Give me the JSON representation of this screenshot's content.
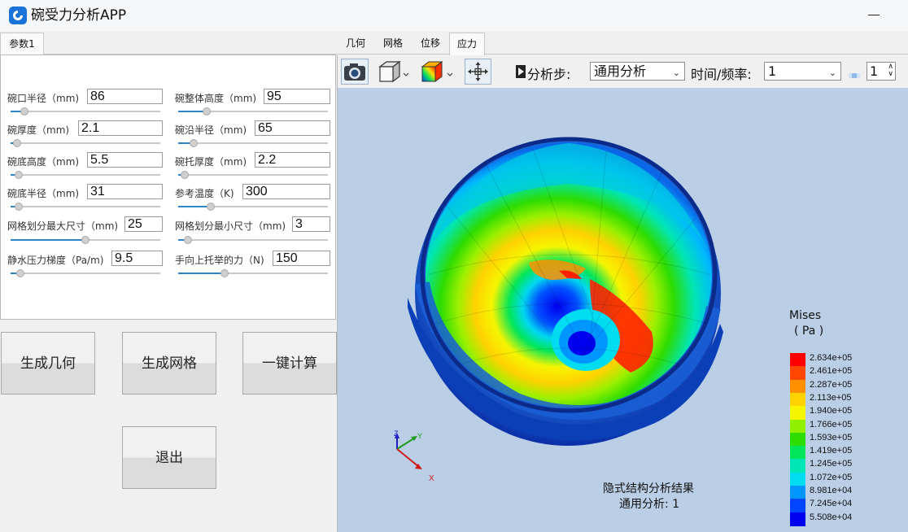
{
  "app": {
    "title": "碗受力分析APP",
    "colors": {
      "accent": "#2c86c9",
      "viewport_bg": "#bacfe6"
    }
  },
  "left_tabs": [
    {
      "label": "参数1",
      "active": true
    }
  ],
  "right_tabs": [
    {
      "label": "几何",
      "active": false
    },
    {
      "label": "网格",
      "active": false
    },
    {
      "label": "位移",
      "active": false
    },
    {
      "label": "应力",
      "active": true
    }
  ],
  "params": {
    "bowl_mouth_radius": {
      "label": "碗口半径（mm)",
      "value": "86",
      "slider": 0.07
    },
    "bowl_body_height": {
      "label": "碗整体高度（mm)",
      "value": "95",
      "slider": 0.17
    },
    "bowl_thickness": {
      "label": "碗厚度（mm)",
      "value": "2.1",
      "slider": 0.02
    },
    "rim_radius": {
      "label": "碗沿半径（mm)",
      "value": "65",
      "slider": 0.08
    },
    "bottom_height": {
      "label": "碗底高度（mm)",
      "value": "5.5",
      "slider": 0.03
    },
    "foot_thickness": {
      "label": "碗托厚度（mm)",
      "value": "2.2",
      "slider": 0.02
    },
    "bottom_radius": {
      "label": "碗底半径（mm)",
      "value": "31",
      "slider": 0.03
    },
    "ref_temperature": {
      "label": "参考温度（K)",
      "value": "300",
      "slider": 0.2
    },
    "mesh_max": {
      "label": "网格划分最大尺寸（mm)",
      "value": "25",
      "slider": 0.5
    },
    "mesh_min": {
      "label": "网格划分最小尺寸（mm)",
      "value": "3",
      "slider": 0.04
    },
    "hydro_gradient": {
      "label": "静水压力梯度（Pa/m)",
      "value": "9.5",
      "slider": 0.04
    },
    "lift_force": {
      "label": "手向上托举的力（N)",
      "value": "150",
      "slider": 0.3
    }
  },
  "buttons": {
    "gen_geometry": "生成几何",
    "gen_mesh": "生成网格",
    "compute": "一键计算",
    "exit": "退出"
  },
  "toolbar": {
    "camera_icon": "camera-icon",
    "view_cube_icon": "view-cube-icon",
    "color_scheme_icon": "color-scheme-icon",
    "zoom_extents_icon": "zoom-extents-icon",
    "analysis_step_label": "分析步:",
    "analysis_step_value": "通用分析",
    "time_freq_label": "时间/频率:",
    "time_freq_value": "1",
    "spin_value": "1"
  },
  "legend": {
    "title": "Mises",
    "unit": "( Pa )",
    "entries": [
      {
        "value": "2.634e+05",
        "color": "#ff0000"
      },
      {
        "value": "2.461e+05",
        "color": "#ff4600"
      },
      {
        "value": "2.287e+05",
        "color": "#ff9100"
      },
      {
        "value": "2.113e+05",
        "color": "#ffd200"
      },
      {
        "value": "1.940e+05",
        "color": "#f5f500"
      },
      {
        "value": "1.766e+05",
        "color": "#91f000"
      },
      {
        "value": "1.593e+05",
        "color": "#2ddc00"
      },
      {
        "value": "1.419e+05",
        "color": "#00e65a"
      },
      {
        "value": "1.245e+05",
        "color": "#00e6b4"
      },
      {
        "value": "1.072e+05",
        "color": "#00dcf0"
      },
      {
        "value": "8.981e+04",
        "color": "#0096ff"
      },
      {
        "value": "7.245e+04",
        "color": "#0046ff"
      },
      {
        "value": "5.508e+04",
        "color": "#0000f0"
      }
    ]
  },
  "caption": {
    "line1": "隐式结构分析结果",
    "line2": "通用分析: 1"
  },
  "axes": {
    "z": "Z",
    "y": "Y",
    "x": "X"
  }
}
